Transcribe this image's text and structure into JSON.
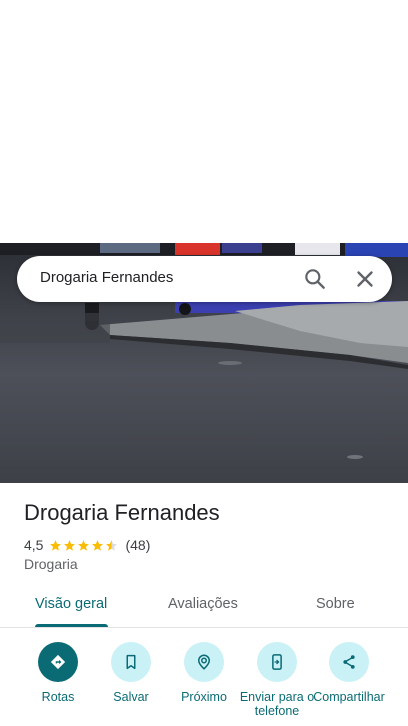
{
  "search": {
    "query": "Drogaria Fernandes"
  },
  "place": {
    "name": "Drogaria Fernandes",
    "rating": "4,5",
    "stars": 4.5,
    "reviews": "(48)",
    "category": "Drogaria"
  },
  "tabs": [
    {
      "label": "Visão geral",
      "active": true
    },
    {
      "label": "Avaliações",
      "active": false
    },
    {
      "label": "Sobre",
      "active": false
    }
  ],
  "actions": [
    {
      "label": "Rotas",
      "icon": "directions-icon"
    },
    {
      "label": "Salvar",
      "icon": "bookmark-icon"
    },
    {
      "label": "Próximo",
      "icon": "nearby-icon"
    },
    {
      "label": "Enviar para o telefone",
      "icon": "send-to-phone-icon"
    },
    {
      "label": "Compartilhar",
      "icon": "share-icon"
    }
  ],
  "colors": {
    "accent": "#0b6b75",
    "accent_light": "#c9f1f6",
    "star": "#fbbc04"
  }
}
